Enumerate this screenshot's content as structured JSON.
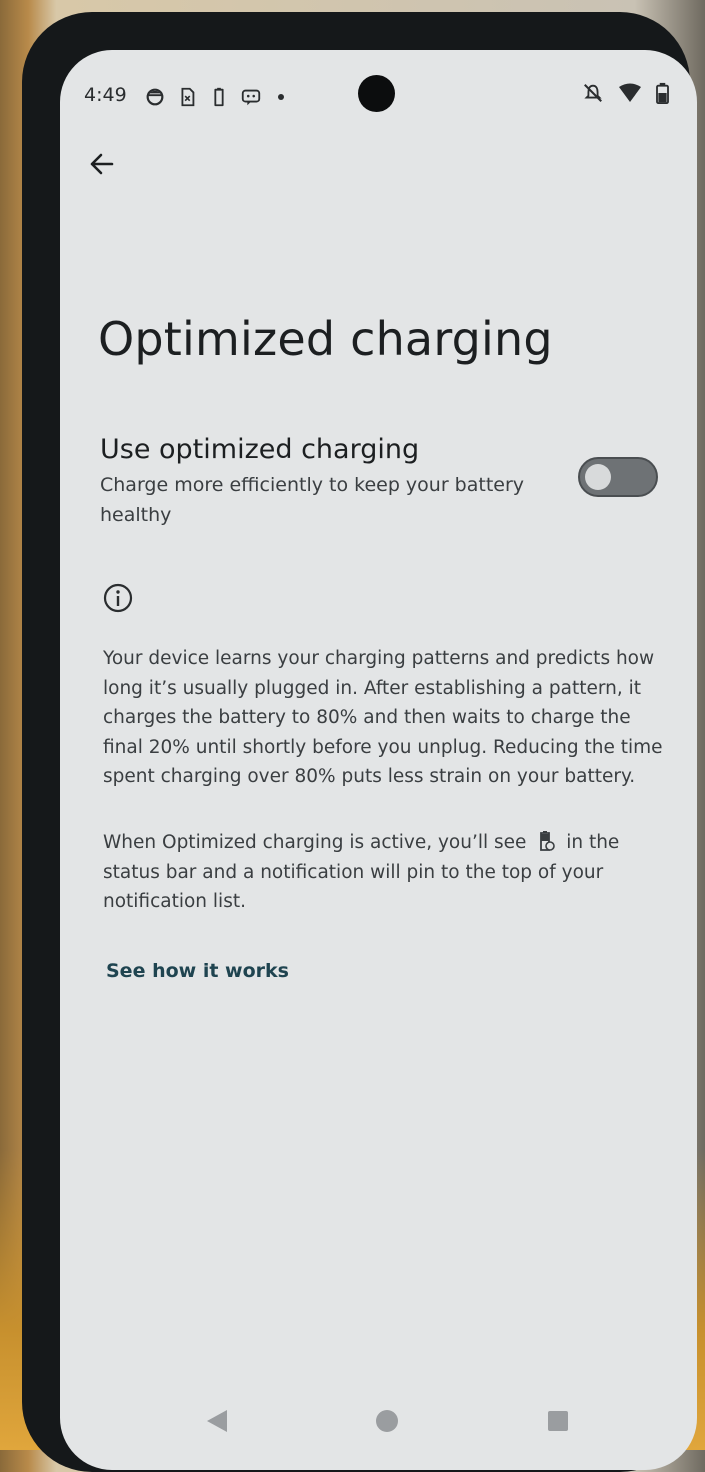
{
  "status_bar": {
    "time": "4:49",
    "left_icons": [
      "data-saver-icon",
      "sim-icon",
      "battery-saver-icon",
      "message-icon",
      "dot"
    ],
    "right_icons": [
      "mute-icon",
      "wifi-icon",
      "battery-icon"
    ]
  },
  "page": {
    "title": "Optimized charging"
  },
  "setting": {
    "title": "Use optimized charging",
    "subtitle": "Charge more efficiently to keep your battery healthy",
    "toggle_on": false
  },
  "info": {
    "paragraph_1": "Your device learns your charging patterns and predicts how long it’s usually plugged in. After establishing a pattern, it charges the battery to 80% and then waits to charge the final 20% until shortly before you unplug. Reducing the time spent charging over 80% puts less strain on your battery.",
    "paragraph_2_before": "When Optimized charging is active, you’ll see",
    "paragraph_2_after": "in the status bar and a notification will pin to the top of your notification list."
  },
  "link": {
    "label": "See how it works"
  },
  "colors": {
    "screen_bg": "#e3e5e6",
    "text_primary": "#1c1f21",
    "link": "#1f4450",
    "toggle_track": "#6e7275"
  }
}
